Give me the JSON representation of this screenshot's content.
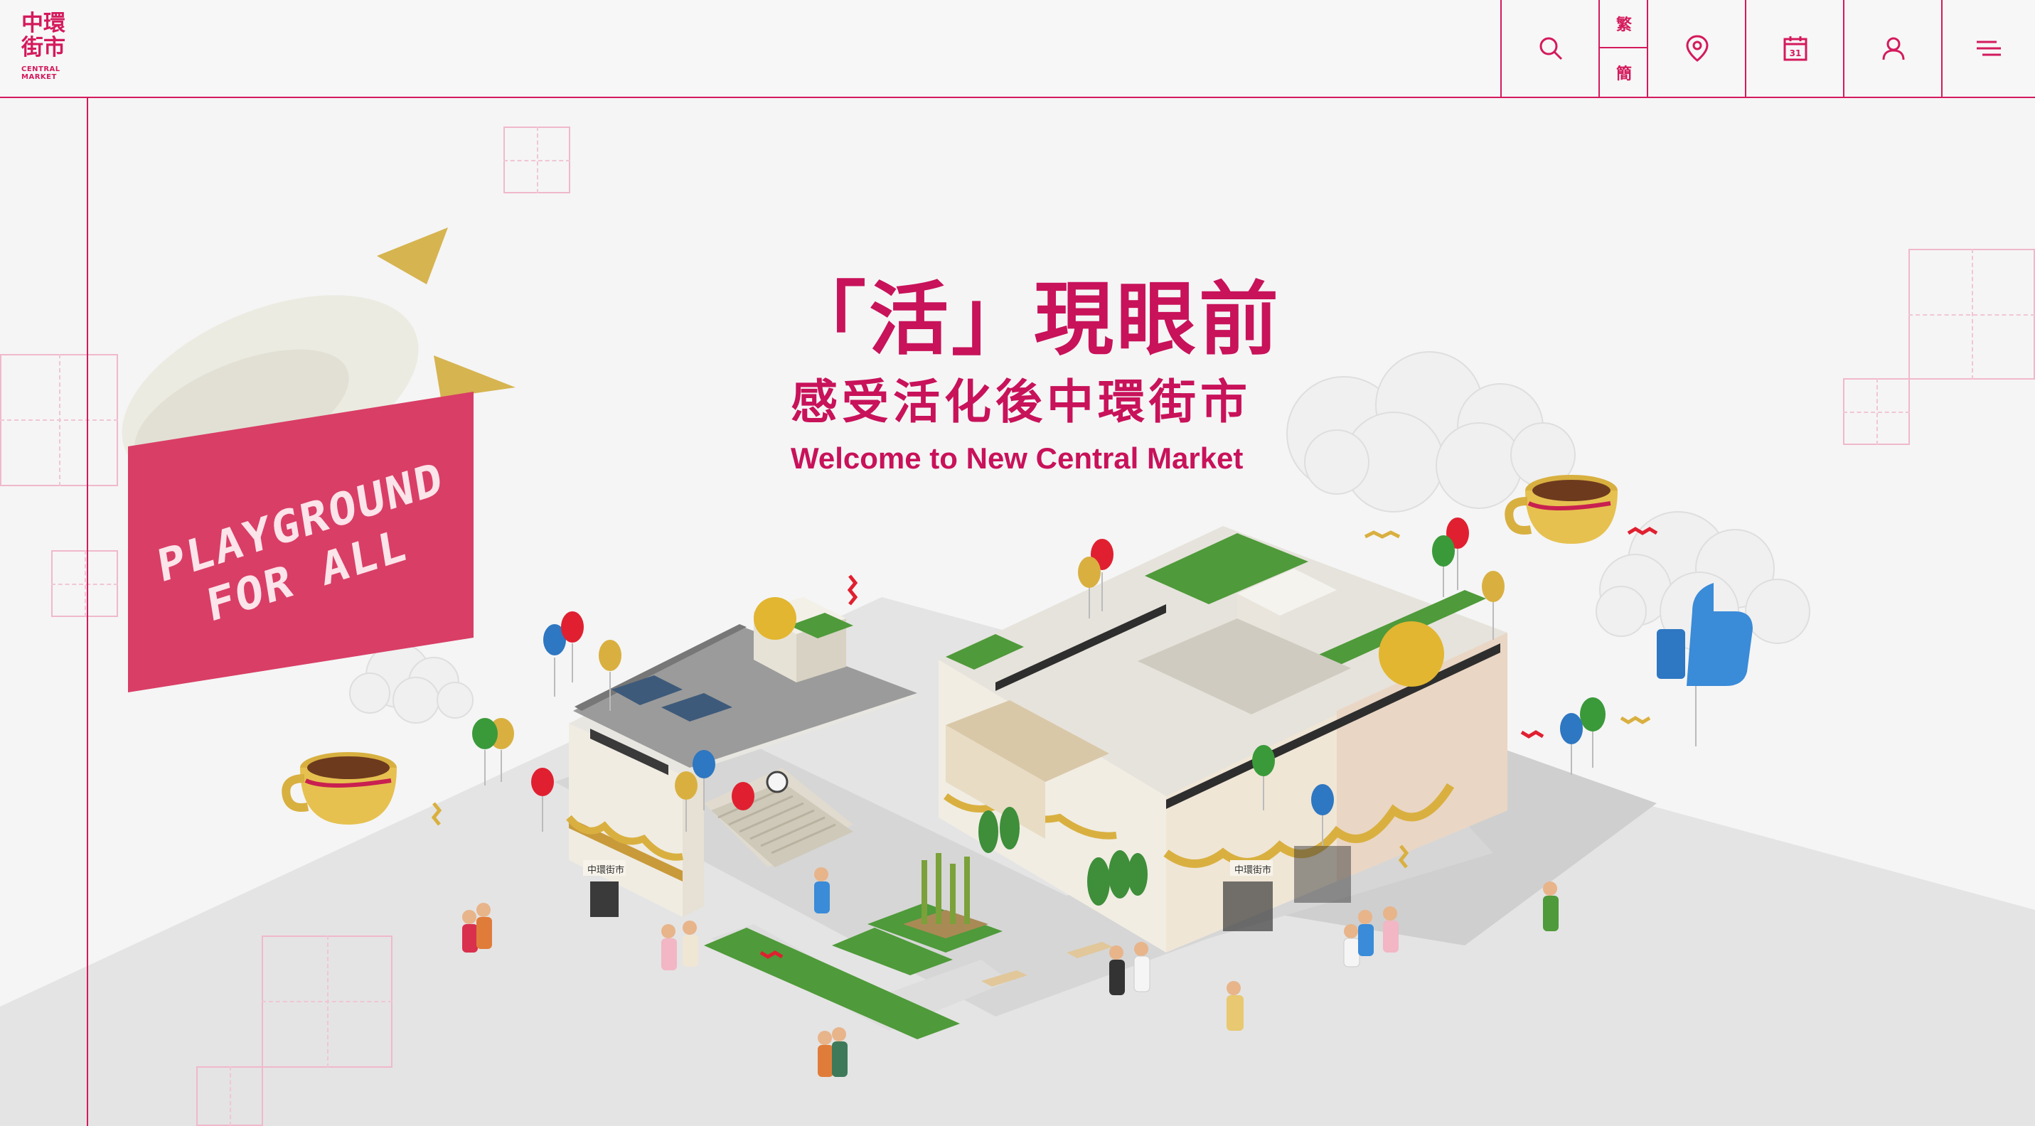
{
  "header": {
    "logo": {
      "zh_line1": "中環",
      "zh_line2": "街市",
      "en": "CENTRAL MARKET"
    },
    "lang_traditional": "繁",
    "lang_simplified": "簡",
    "icons": [
      "search-icon",
      "location-icon",
      "calendar-icon",
      "user-icon",
      "menu-icon"
    ],
    "calendar_day": "31"
  },
  "hero": {
    "headline": "「活」現眼前",
    "subheadline": "感受活化後中環街市",
    "english": "Welcome to New Central Market",
    "banner_line1": "PLAYGROUND",
    "banner_line2": "FOR ALL",
    "building_sign_left": "中環街市",
    "building_sign_right": "中環街市"
  },
  "colors": {
    "accent": "#d41a5c",
    "headline": "#c8125a",
    "banner": "#d93e66",
    "background": "#f5f5f5"
  }
}
